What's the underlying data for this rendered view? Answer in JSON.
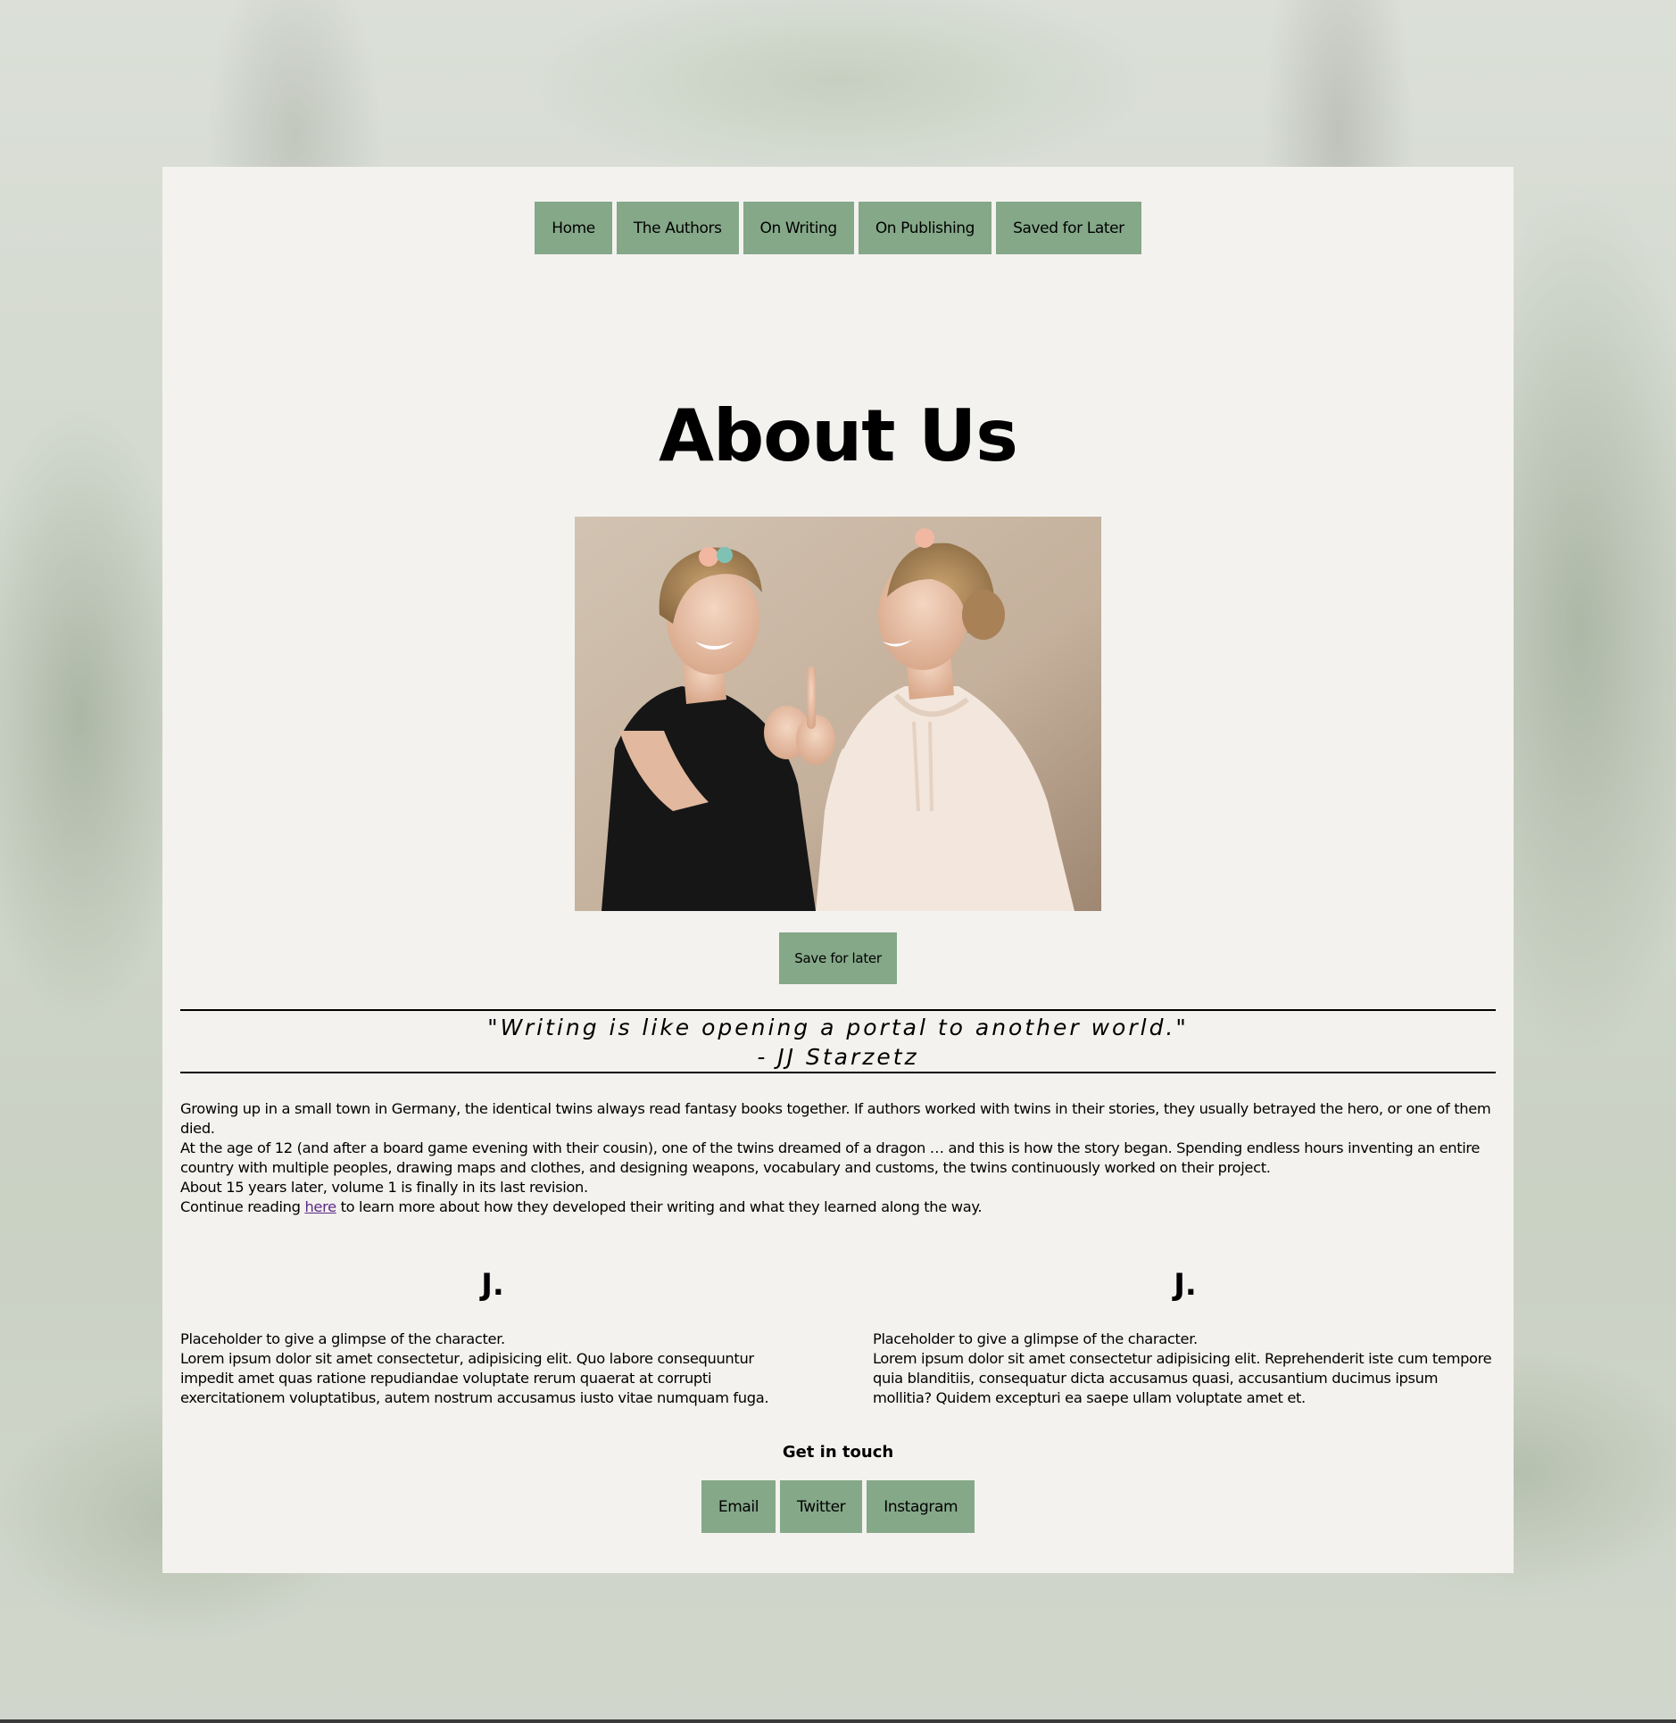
{
  "nav": {
    "items": [
      "Home",
      "The Authors",
      "On Writing",
      "On Publishing",
      "Saved for Later"
    ]
  },
  "page_title": "About Us",
  "photo": {
    "description_icon": "twins-photo"
  },
  "save_button": "Save for later",
  "quote": {
    "text": "\"Writing is like opening a portal to another world.\"",
    "author": "- JJ Starzetz"
  },
  "story": {
    "p1": "Growing up in a small town in Germany, the identical twins always read fantasy books together. If authors worked with twins in their stories, they usually betrayed the hero, or one of them died.",
    "p2": "At the age of 12 (and after a board game evening with their cousin), one of the twins dreamed of a dragon … and this is how the story began. Spending endless hours inventing an entire country with multiple peoples, drawing maps and clothes, and designing weapons, vocabulary and customs, the twins continuously worked on their project.",
    "p3": "About 15 years later, volume 1 is finally in its last revision.",
    "p4_before": "Continue reading ",
    "p4_link": "here",
    "p4_after": " to learn more about how they developed their writing and what they learned along the way."
  },
  "authors": [
    {
      "name": "J.",
      "intro": "Placeholder to give a glimpse of the character.",
      "bio": "Lorem ipsum dolor sit amet consectetur, adipisicing elit. Quo labore consequuntur impedit amet quas ratione repudiandae voluptate rerum quaerat at corrupti exercitationem voluptatibus, autem nostrum accusamus iusto vitae numquam fuga."
    },
    {
      "name": "J.",
      "intro": "Placeholder to give a glimpse of the character.",
      "bio": "Lorem ipsum dolor sit amet consectetur adipisicing elit. Reprehenderit iste cum tempore quia blanditiis, consequatur dicta accusamus quasi, accusantium ducimus ipsum mollitia? Quidem excepturi ea saepe ullam voluptate amet et."
    }
  ],
  "contact": {
    "title": "Get in touch",
    "items": [
      "Email",
      "Twitter",
      "Instagram"
    ]
  },
  "colors": {
    "button": "#85a889",
    "panel": "#f4f2ef",
    "link": "#5b2a86"
  }
}
